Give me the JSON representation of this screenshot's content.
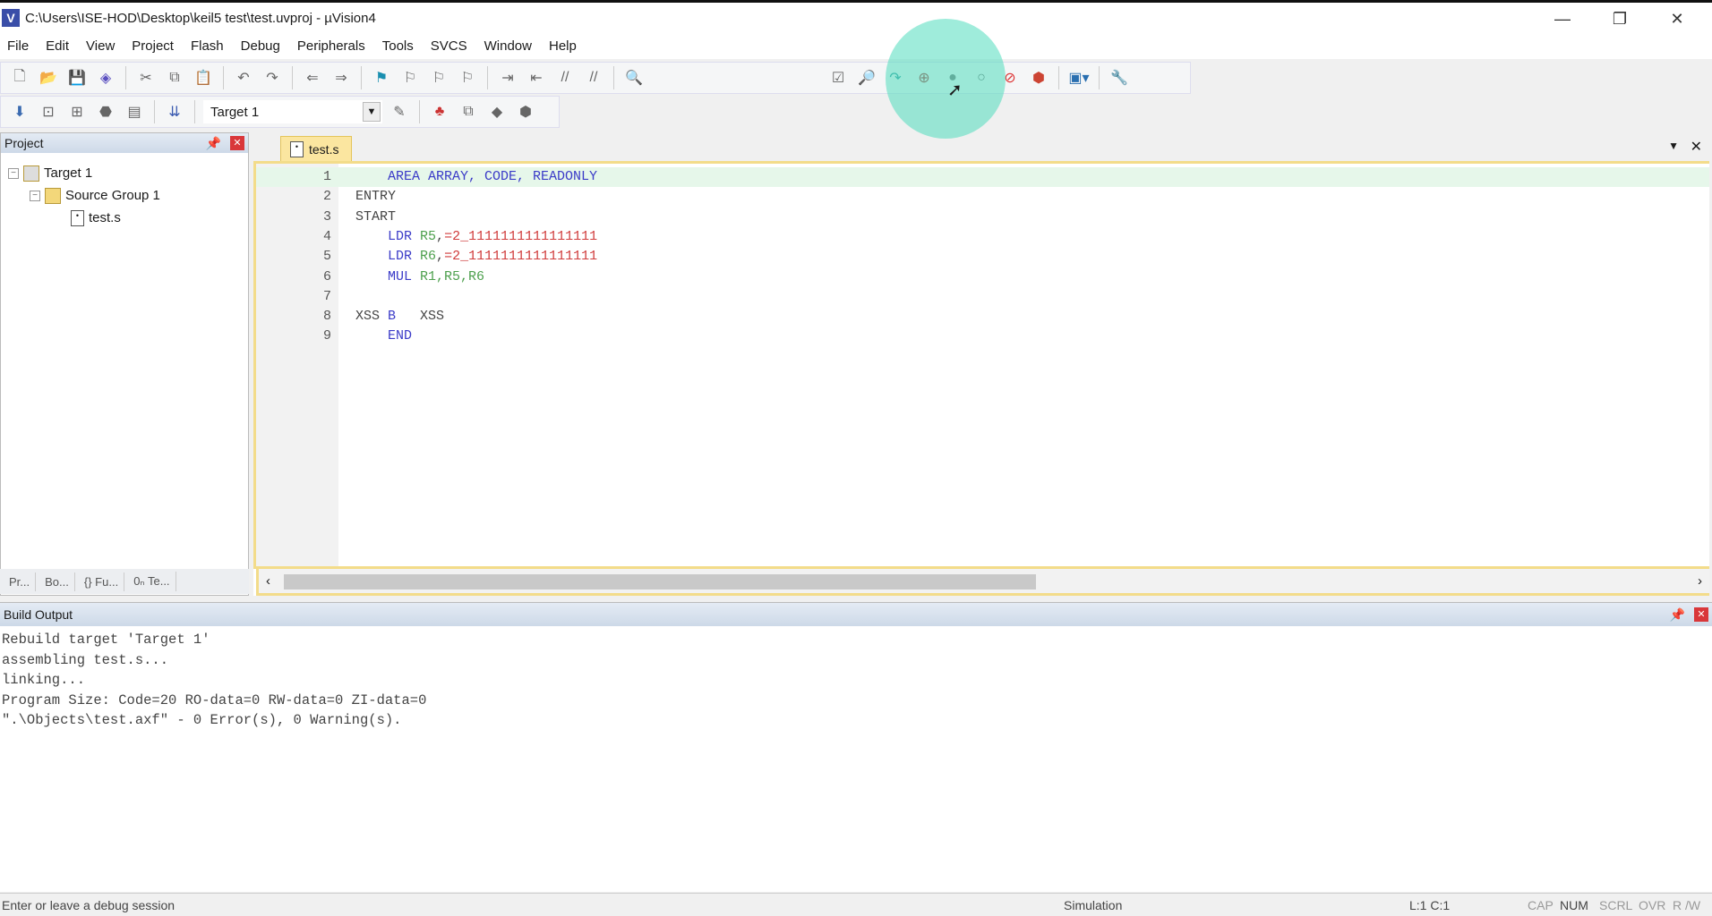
{
  "window": {
    "title": "C:\\Users\\ISE-HOD\\Desktop\\keil5 test\\test.uvproj - µVision4",
    "min": "—",
    "restore": "❐",
    "close": "✕"
  },
  "menu": [
    "File",
    "Edit",
    "View",
    "Project",
    "Flash",
    "Debug",
    "Peripherals",
    "Tools",
    "SVCS",
    "Window",
    "Help"
  ],
  "toolbar": {
    "target_select": "Target 1"
  },
  "project": {
    "title": "Project",
    "tree": {
      "target": "Target 1",
      "group": "Source Group 1",
      "file": "test.s"
    },
    "tabs": [
      "Pr...",
      "Bo...",
      "{} Fu...",
      "0ₙ Te..."
    ]
  },
  "editor": {
    "tab": "test.s",
    "lines": [
      {
        "n": "1",
        "parts": [
          [
            "    ",
            "plain"
          ],
          [
            "AREA ARRAY, CODE, READONLY",
            "kw"
          ]
        ]
      },
      {
        "n": "2",
        "parts": [
          [
            "ENTRY",
            "plain"
          ]
        ]
      },
      {
        "n": "3",
        "parts": [
          [
            "START",
            "plain"
          ]
        ]
      },
      {
        "n": "4",
        "parts": [
          [
            "    ",
            "plain"
          ],
          [
            "LDR ",
            "kw"
          ],
          [
            "R5",
            "reg"
          ],
          [
            ",",
            "plain"
          ],
          [
            "=2_1111111111111111",
            "lit"
          ]
        ]
      },
      {
        "n": "5",
        "parts": [
          [
            "    ",
            "plain"
          ],
          [
            "LDR ",
            "kw"
          ],
          [
            "R6",
            "reg"
          ],
          [
            ",",
            "plain"
          ],
          [
            "=2_1111111111111111",
            "lit"
          ]
        ]
      },
      {
        "n": "6",
        "parts": [
          [
            "    ",
            "plain"
          ],
          [
            "MUL ",
            "kw"
          ],
          [
            "R1,R5,R6",
            "reg"
          ]
        ]
      },
      {
        "n": "7",
        "parts": []
      },
      {
        "n": "8",
        "parts": [
          [
            "XSS ",
            "plain"
          ],
          [
            "B",
            "kw"
          ],
          [
            "   XSS",
            "plain"
          ]
        ]
      },
      {
        "n": "9",
        "parts": [
          [
            "    ",
            "plain"
          ],
          [
            "END",
            "kw"
          ]
        ]
      }
    ]
  },
  "build": {
    "title": "Build Output",
    "lines": [
      "Rebuild target 'Target 1'",
      "assembling test.s...",
      "linking...",
      "Program Size: Code=20 RO-data=0 RW-data=0 ZI-data=0",
      "\".\\Objects\\test.axf\" - 0 Error(s), 0 Warning(s)."
    ]
  },
  "status": {
    "hint": "Enter or leave a debug session",
    "mode": "Simulation",
    "pos": "L:1 C:1",
    "cap": "CAP",
    "num": "NUM",
    "scrl": "SCRL",
    "ovr": "OVR",
    "rw": "R /W"
  }
}
